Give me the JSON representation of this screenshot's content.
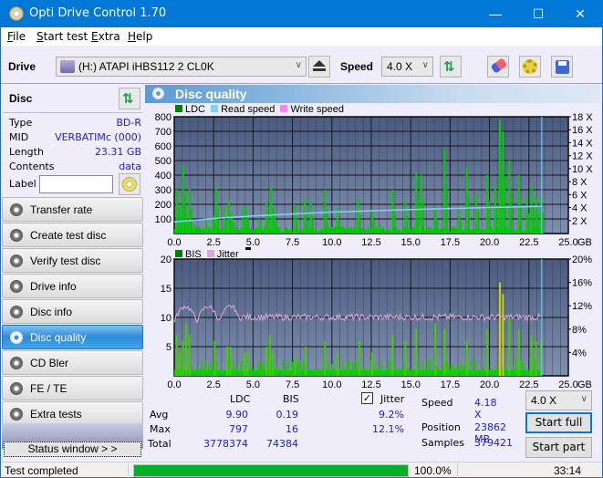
{
  "window": {
    "title": "Opti Drive Control 1.70",
    "minimize": "—",
    "maximize": "☐",
    "close": "✕"
  },
  "menu": [
    {
      "label": "File",
      "key": "F",
      "rest": "ile"
    },
    {
      "label": "Start test",
      "key": "S",
      "rest": "tart test"
    },
    {
      "label": "Extra",
      "key": "E",
      "rest": "xtra"
    },
    {
      "label": "Help",
      "key": "H",
      "rest": "elp"
    }
  ],
  "toolbar": {
    "drive_label": "Drive",
    "drive_value": "(H:)  ATAPI iHBS112  2 CL0K",
    "speed_label": "Speed",
    "speed_value": "4.0 X",
    "icons": [
      "eject-icon",
      "refresh-icon",
      "erase-icon",
      "settings-icon",
      "save-icon"
    ]
  },
  "disc": {
    "header": "Disc",
    "rows": [
      {
        "key": "Type",
        "value": "BD-R"
      },
      {
        "key": "MID",
        "value": "VERBATIMc (000)"
      },
      {
        "key": "Length",
        "value": "23.31 GB"
      },
      {
        "key": "Contents",
        "value": "data"
      }
    ],
    "label_key": "Label",
    "label_value": ""
  },
  "nav": [
    {
      "label": "Transfer rate",
      "active": false
    },
    {
      "label": "Create test disc",
      "active": false
    },
    {
      "label": "Verify test disc",
      "active": false
    },
    {
      "label": "Drive info",
      "active": false
    },
    {
      "label": "Disc info",
      "active": false
    },
    {
      "label": "Disc quality",
      "active": true
    },
    {
      "label": "CD Bler",
      "active": false
    },
    {
      "label": "FE / TE",
      "active": false
    },
    {
      "label": "Extra tests",
      "active": false
    }
  ],
  "status_window_label": "Status window > >",
  "panel_title": "Disc quality",
  "chart_data": [
    {
      "type": "bar",
      "title": "LDC",
      "legend": [
        {
          "name": "LDC",
          "color": "#008000"
        },
        {
          "name": "Read speed",
          "color": "#7fcfff"
        },
        {
          "name": "Write speed",
          "color": "#ff80ff"
        }
      ],
      "xlabel": "GB",
      "xlim": [
        0,
        25
      ],
      "xticks": [
        "0.0",
        "2.5",
        "5.0",
        "7.5",
        "10.0",
        "12.5",
        "15.0",
        "17.5",
        "20.0",
        "22.5",
        "25.0"
      ],
      "ylim": [
        0,
        800
      ],
      "yticks": [
        "100",
        "200",
        "300",
        "400",
        "500",
        "600",
        "700",
        "800"
      ],
      "y2lim": [
        0,
        18
      ],
      "y2ticks": [
        "2 X",
        "4 X",
        "6 X",
        "8 X",
        "10 X",
        "12 X",
        "14 X",
        "16 X",
        "18 X"
      ],
      "end_gb": 23.31,
      "ldc_peaks": [
        [
          0.1,
          300
        ],
        [
          0.3,
          200
        ],
        [
          0.5,
          470
        ],
        [
          0.7,
          150
        ],
        [
          0.9,
          310
        ],
        [
          1.2,
          60
        ],
        [
          2.0,
          80
        ],
        [
          2.4,
          120
        ],
        [
          2.6,
          310
        ],
        [
          3.1,
          180
        ],
        [
          3.4,
          230
        ],
        [
          3.6,
          140
        ],
        [
          4.3,
          170
        ],
        [
          4.5,
          190
        ],
        [
          5.3,
          100
        ],
        [
          5.8,
          220
        ],
        [
          6.1,
          320
        ],
        [
          6.3,
          150
        ],
        [
          7.6,
          200
        ],
        [
          8.2,
          240
        ],
        [
          8.6,
          220
        ],
        [
          9.5,
          300
        ],
        [
          10.3,
          170
        ],
        [
          11.6,
          240
        ],
        [
          12.5,
          160
        ],
        [
          13.0,
          60
        ],
        [
          13.8,
          300
        ],
        [
          14.6,
          220
        ],
        [
          15.3,
          420
        ],
        [
          15.6,
          400
        ],
        [
          16.5,
          180
        ],
        [
          17.1,
          580
        ],
        [
          18.0,
          150
        ],
        [
          18.5,
          450
        ],
        [
          19.1,
          280
        ],
        [
          19.8,
          400
        ],
        [
          20.3,
          330
        ],
        [
          20.6,
          780
        ],
        [
          20.8,
          700
        ],
        [
          21.2,
          500
        ],
        [
          21.8,
          400
        ],
        [
          22.3,
          250
        ],
        [
          22.6,
          330
        ],
        [
          22.9,
          250
        ],
        [
          23.2,
          260
        ]
      ],
      "read_speed": [
        [
          0,
          1.8
        ],
        [
          1.5,
          2.1
        ],
        [
          3,
          2.4
        ],
        [
          5,
          2.7
        ],
        [
          7.5,
          3.0
        ],
        [
          10,
          3.3
        ],
        [
          12.5,
          3.5
        ],
        [
          15,
          3.7
        ],
        [
          17.5,
          3.85
        ],
        [
          20,
          4.0
        ],
        [
          23.3,
          4.18
        ]
      ]
    },
    {
      "type": "bar",
      "title": "BIS",
      "legend": [
        {
          "name": "BIS",
          "color": "#008000"
        },
        {
          "name": "Jitter",
          "color": "#d8a8d8"
        }
      ],
      "xlabel": "GB",
      "xlim": [
        0,
        25
      ],
      "xticks": [
        "0.0",
        "2.5",
        "5.0",
        "7.5",
        "10.0",
        "12.5",
        "15.0",
        "17.5",
        "20.0",
        "22.5",
        "25.0"
      ],
      "ylim": [
        0,
        20
      ],
      "yticks": [
        "5",
        "10",
        "15",
        "20"
      ],
      "y2lim": [
        0,
        20
      ],
      "y2ticks": [
        "4%",
        "8%",
        "12%",
        "16%",
        "20%"
      ],
      "end_gb": 23.31,
      "bis_peaks": [
        [
          0.1,
          7
        ],
        [
          0.3,
          4
        ],
        [
          0.5,
          6
        ],
        [
          0.7,
          9
        ],
        [
          0.9,
          7
        ],
        [
          2.5,
          6
        ],
        [
          3.3,
          5
        ],
        [
          3.5,
          5
        ],
        [
          4.4,
          4
        ],
        [
          4.6,
          4
        ],
        [
          5.8,
          5
        ],
        [
          6.0,
          7
        ],
        [
          6.2,
          4
        ],
        [
          7.6,
          3
        ],
        [
          8.3,
          5
        ],
        [
          9.5,
          6
        ],
        [
          10.3,
          4
        ],
        [
          11.7,
          6
        ],
        [
          12.5,
          4
        ],
        [
          13.8,
          7
        ],
        [
          14.6,
          6
        ],
        [
          15.3,
          8
        ],
        [
          16.5,
          9
        ],
        [
          17.1,
          8
        ],
        [
          18.5,
          6
        ],
        [
          19.8,
          8
        ],
        [
          20.6,
          16
        ],
        [
          20.8,
          14
        ],
        [
          21.2,
          10
        ],
        [
          21.8,
          8
        ],
        [
          22.6,
          7
        ],
        [
          22.9,
          6
        ],
        [
          23.2,
          6
        ]
      ],
      "jitter_mean": 9.2,
      "jitter_max": 12.1
    }
  ],
  "stats": {
    "col_ldc": "LDC",
    "col_bis": "BIS",
    "jitter_label": "Jitter",
    "jitter_checked": true,
    "rows": [
      {
        "label": "Avg",
        "ldc": "9.90",
        "bis": "0.19",
        "jitter": "9.2%"
      },
      {
        "label": "Max",
        "ldc": "797",
        "bis": "16",
        "jitter": "12.1%"
      },
      {
        "label": "Total",
        "ldc": "3778374",
        "bis": "74384",
        "jitter": ""
      }
    ],
    "speed_label": "Speed",
    "speed_value": "4.18 X",
    "position_label": "Position",
    "position_value": "23862 MB",
    "samples_label": "Samples",
    "samples_value": "379421",
    "speed_select": "4.0 X",
    "start_full": "Start full",
    "start_part": "Start part"
  },
  "statusbar": {
    "text": "Test completed",
    "progress": 100.0,
    "progress_text": "100.0%",
    "time": "33:14"
  }
}
